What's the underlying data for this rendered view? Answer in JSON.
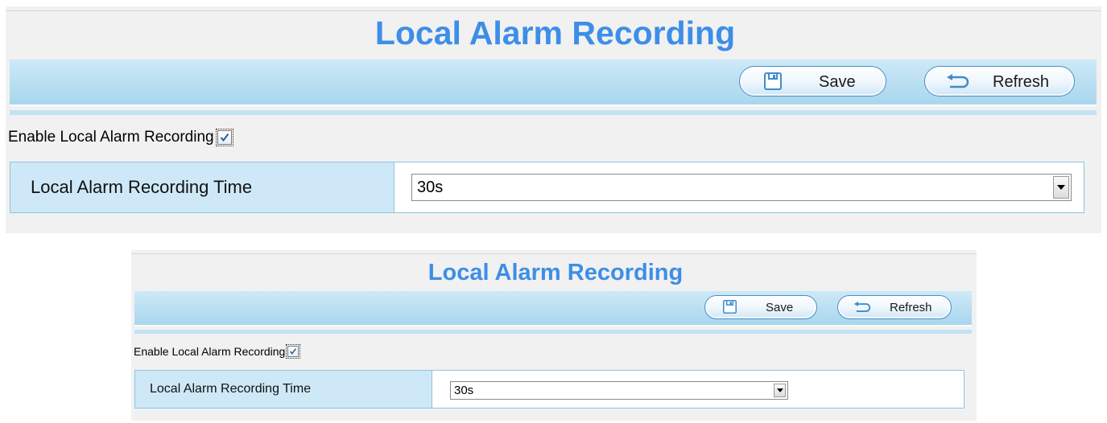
{
  "page": {
    "title": "Local Alarm Recording",
    "toolbar": {
      "save_label": "Save",
      "refresh_label": "Refresh"
    },
    "enable_label": "Enable Local Alarm Recording",
    "enable_checked": true,
    "setting": {
      "label": "Local Alarm Recording Time",
      "value": "30s"
    }
  },
  "icons": {
    "save": "floppy-disk-icon",
    "refresh": "refresh-arrow-icon",
    "dropdown": "chevron-down-icon",
    "check": "checkmark-icon"
  },
  "colors": {
    "title": "#3d8ee8",
    "toolbar": "#a9d6ee",
    "label_cell": "#cfe8f7",
    "border": "#8cc4e2"
  }
}
